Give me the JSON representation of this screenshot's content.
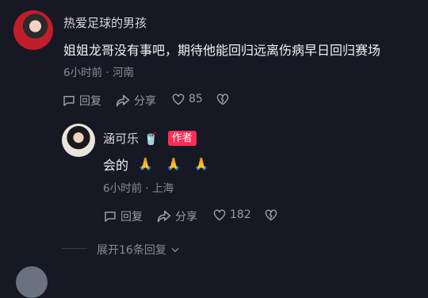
{
  "comment": {
    "username": "热爱足球的男孩",
    "text": "姐姐龙哥没有事吧，期待他能回归远离伤病早日回归赛场",
    "time_location": "6小时前 · 河南",
    "actions": {
      "reply_label": "回复",
      "share_label": "分享",
      "like_count": "85"
    }
  },
  "reply": {
    "username": "涵可乐",
    "username_emoji": "🥤",
    "author_badge": "作者",
    "text": "会的",
    "emojis": "🙏 🙏 🙏",
    "time_location": "6小时前 · 上海",
    "actions": {
      "reply_label": "回复",
      "share_label": "分享",
      "like_count": "182"
    }
  },
  "expand": {
    "label": "展开16条回复"
  },
  "colors": {
    "background": "#161823",
    "badge": "#fe2c55",
    "muted": "#8a8b91"
  }
}
